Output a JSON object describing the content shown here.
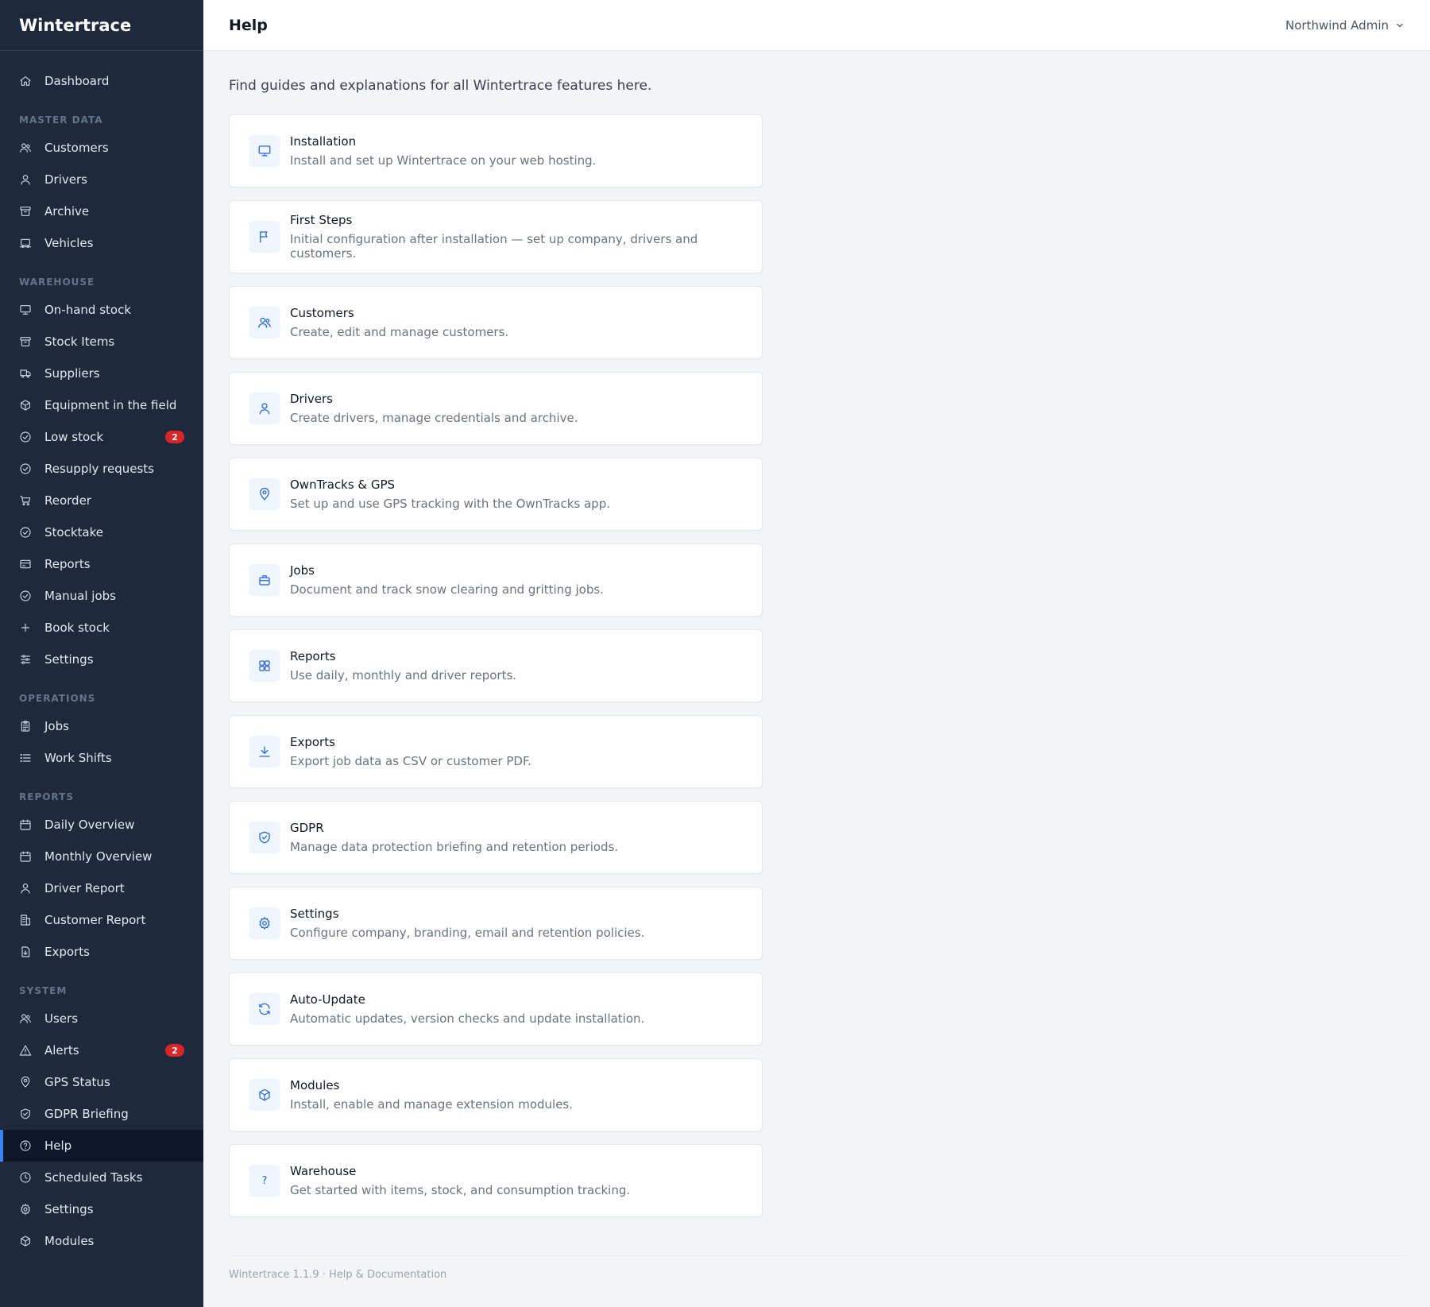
{
  "app": {
    "name": "Wintertrace"
  },
  "header": {
    "title": "Help",
    "user": "Northwind Admin",
    "user_chevron_icon": "chevron-down-icon"
  },
  "sidebar": {
    "items": [
      {
        "type": "item",
        "key": "dashboard",
        "label": "Dashboard",
        "icon": "home"
      },
      {
        "type": "section",
        "label": "MASTER DATA"
      },
      {
        "type": "item",
        "key": "customers",
        "label": "Customers",
        "icon": "users"
      },
      {
        "type": "item",
        "key": "drivers",
        "label": "Drivers",
        "icon": "user"
      },
      {
        "type": "item",
        "key": "archive",
        "label": "Archive",
        "icon": "archive"
      },
      {
        "type": "item",
        "key": "vehicles",
        "label": "Vehicles",
        "icon": "truck-screen"
      },
      {
        "type": "section",
        "label": "WAREHOUSE"
      },
      {
        "type": "item",
        "key": "on-hand-stock",
        "label": "On-hand stock",
        "icon": "monitor"
      },
      {
        "type": "item",
        "key": "stock-items",
        "label": "Stock Items",
        "icon": "archive"
      },
      {
        "type": "item",
        "key": "suppliers",
        "label": "Suppliers",
        "icon": "truck"
      },
      {
        "type": "item",
        "key": "equipment",
        "label": "Equipment in the field",
        "icon": "cube"
      },
      {
        "type": "item",
        "key": "low-stock",
        "label": "Low stock",
        "icon": "check-circle",
        "badge": "2"
      },
      {
        "type": "item",
        "key": "resupply",
        "label": "Resupply requests",
        "icon": "check-circle"
      },
      {
        "type": "item",
        "key": "reorder",
        "label": "Reorder",
        "icon": "cart"
      },
      {
        "type": "item",
        "key": "stocktake",
        "label": "Stocktake",
        "icon": "check-circle"
      },
      {
        "type": "item",
        "key": "reports-wh",
        "label": "Reports",
        "icon": "card"
      },
      {
        "type": "item",
        "key": "manual-jobs",
        "label": "Manual jobs",
        "icon": "check-circle"
      },
      {
        "type": "item",
        "key": "book-stock",
        "label": "Book stock",
        "icon": "plus"
      },
      {
        "type": "item",
        "key": "settings-wh",
        "label": "Settings",
        "icon": "sliders"
      },
      {
        "type": "section",
        "label": "OPERATIONS"
      },
      {
        "type": "item",
        "key": "jobs",
        "label": "Jobs",
        "icon": "clipboard"
      },
      {
        "type": "item",
        "key": "work-shifts",
        "label": "Work Shifts",
        "icon": "list"
      },
      {
        "type": "section",
        "label": "REPORTS"
      },
      {
        "type": "item",
        "key": "daily-overview",
        "label": "Daily Overview",
        "icon": "calendar"
      },
      {
        "type": "item",
        "key": "monthly-overview",
        "label": "Monthly Overview",
        "icon": "calendar"
      },
      {
        "type": "item",
        "key": "driver-report",
        "label": "Driver Report",
        "icon": "user"
      },
      {
        "type": "item",
        "key": "customer-report",
        "label": "Customer Report",
        "icon": "building"
      },
      {
        "type": "item",
        "key": "exports",
        "label": "Exports",
        "icon": "file-download"
      },
      {
        "type": "section",
        "label": "SYSTEM"
      },
      {
        "type": "item",
        "key": "users",
        "label": "Users",
        "icon": "users"
      },
      {
        "type": "item",
        "key": "alerts",
        "label": "Alerts",
        "icon": "warning",
        "badge": "2"
      },
      {
        "type": "item",
        "key": "gps-status",
        "label": "GPS Status",
        "icon": "pin"
      },
      {
        "type": "item",
        "key": "gdpr-briefing",
        "label": "GDPR Briefing",
        "icon": "shield"
      },
      {
        "type": "item",
        "key": "help",
        "label": "Help",
        "icon": "question",
        "active": true
      },
      {
        "type": "item",
        "key": "scheduled-tasks",
        "label": "Scheduled Tasks",
        "icon": "clock"
      },
      {
        "type": "item",
        "key": "settings",
        "label": "Settings",
        "icon": "gear"
      },
      {
        "type": "item",
        "key": "modules",
        "label": "Modules",
        "icon": "cube"
      }
    ]
  },
  "main": {
    "intro": "Find guides and explanations for all Wintertrace features here.",
    "cards": [
      {
        "key": "installation",
        "title": "Installation",
        "desc": "Install and set up Wintertrace on your web hosting.",
        "icon": "monitor"
      },
      {
        "key": "first-steps",
        "title": "First Steps",
        "desc": "Initial configuration after installation — set up company, drivers and customers.",
        "icon": "flag"
      },
      {
        "key": "customers",
        "title": "Customers",
        "desc": "Create, edit and manage customers.",
        "icon": "users"
      },
      {
        "key": "drivers",
        "title": "Drivers",
        "desc": "Create drivers, manage credentials and archive.",
        "icon": "user"
      },
      {
        "key": "owntracks-gps",
        "title": "OwnTracks & GPS",
        "desc": "Set up and use GPS tracking with the OwnTracks app.",
        "icon": "pin"
      },
      {
        "key": "jobs",
        "title": "Jobs",
        "desc": "Document and track snow clearing and gritting jobs.",
        "icon": "briefcase"
      },
      {
        "key": "reports",
        "title": "Reports",
        "desc": "Use daily, monthly and driver reports.",
        "icon": "grid"
      },
      {
        "key": "exports",
        "title": "Exports",
        "desc": "Export job data as CSV or customer PDF.",
        "icon": "download"
      },
      {
        "key": "gdpr",
        "title": "GDPR",
        "desc": "Manage data protection briefing and retention periods.",
        "icon": "shield"
      },
      {
        "key": "settings",
        "title": "Settings",
        "desc": "Configure company, branding, email and retention policies.",
        "icon": "gear"
      },
      {
        "key": "auto-update",
        "title": "Auto-Update",
        "desc": "Automatic updates, version checks and update installation.",
        "icon": "refresh"
      },
      {
        "key": "modules",
        "title": "Modules",
        "desc": "Install, enable and manage extension modules.",
        "icon": "cube"
      },
      {
        "key": "warehouse",
        "title": "Warehouse",
        "desc": "Get started with items, stock, and consumption tracking.",
        "icon": "question-mark",
        "glyph": "?"
      }
    ]
  },
  "footer": {
    "text": "Wintertrace 1.1.9 · Help & Documentation"
  },
  "colors": {
    "sidebar_bg": "#1e293b",
    "active_bg": "#0f172a",
    "accent": "#3b82f6",
    "badge": "#dc2626",
    "icon_blue": "#2563eb"
  }
}
